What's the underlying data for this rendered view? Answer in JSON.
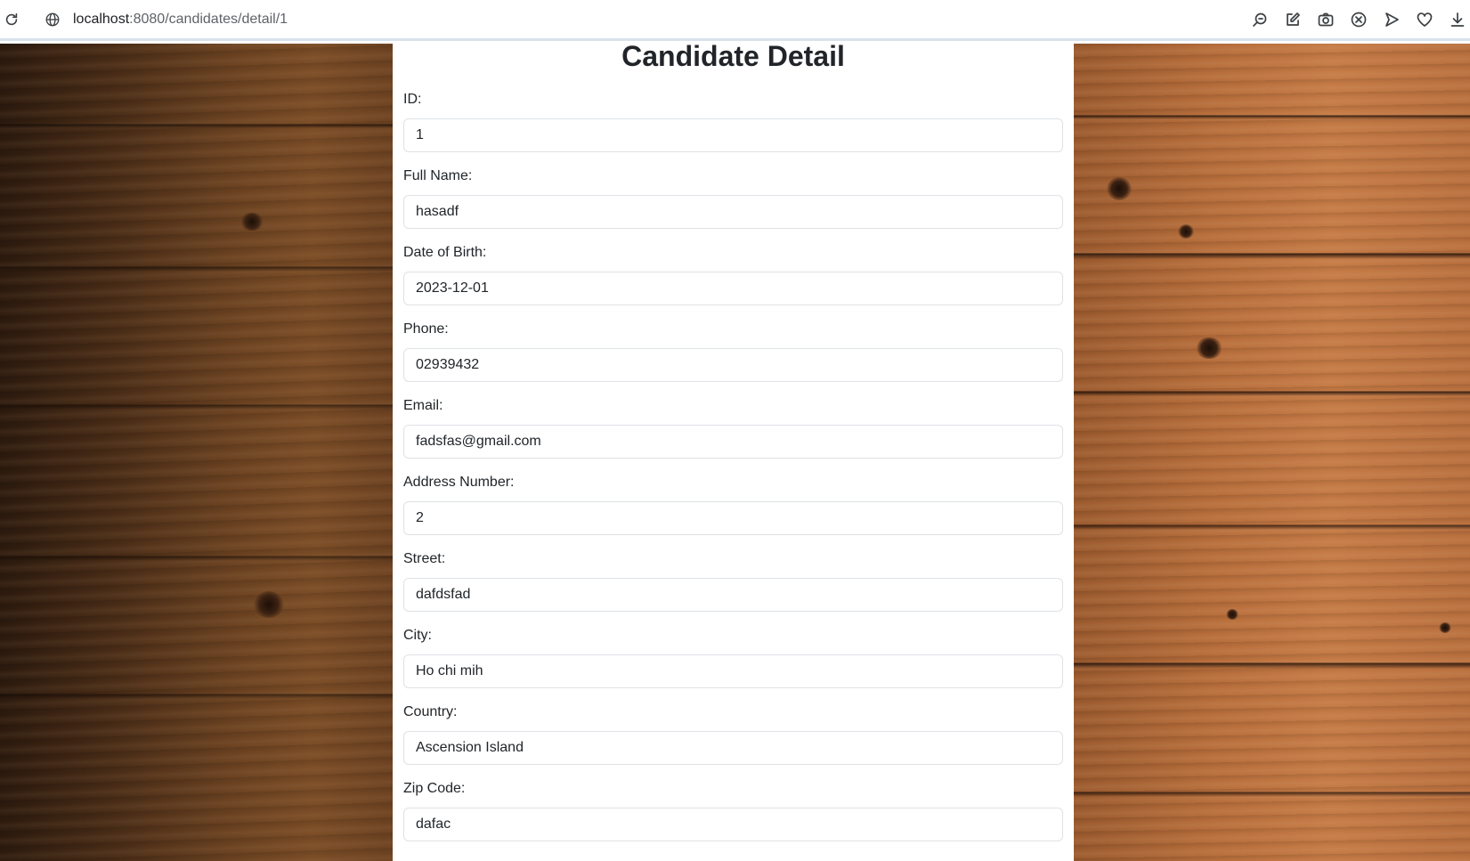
{
  "browser": {
    "url_host": "localhost",
    "url_path": ":8080/candidates/detail/1",
    "toolbar_icons": [
      "zoom-icon",
      "edit-icon",
      "camera-icon",
      "close-circle-icon",
      "send-icon",
      "heart-icon",
      "download-icon"
    ]
  },
  "page": {
    "title": "Candidate Detail"
  },
  "form": {
    "fields": [
      {
        "label": "ID:",
        "value": "1"
      },
      {
        "label": "Full Name:",
        "value": "hasadf"
      },
      {
        "label": "Date of Birth:",
        "value": "2023-12-01"
      },
      {
        "label": "Phone:",
        "value": "02939432"
      },
      {
        "label": "Email:",
        "value": "fadsfas@gmail.com"
      },
      {
        "label": "Address Number:",
        "value": "2"
      },
      {
        "label": "Street:",
        "value": "dafdsfad"
      },
      {
        "label": "City:",
        "value": "Ho chi mih"
      },
      {
        "label": "Country:",
        "value": "Ascension Island"
      },
      {
        "label": "Zip Code:",
        "value": "dafac"
      }
    ]
  },
  "colors": {
    "text": "#212529",
    "input_border": "#dee2e6",
    "address_bar_path": "#5f6368"
  }
}
